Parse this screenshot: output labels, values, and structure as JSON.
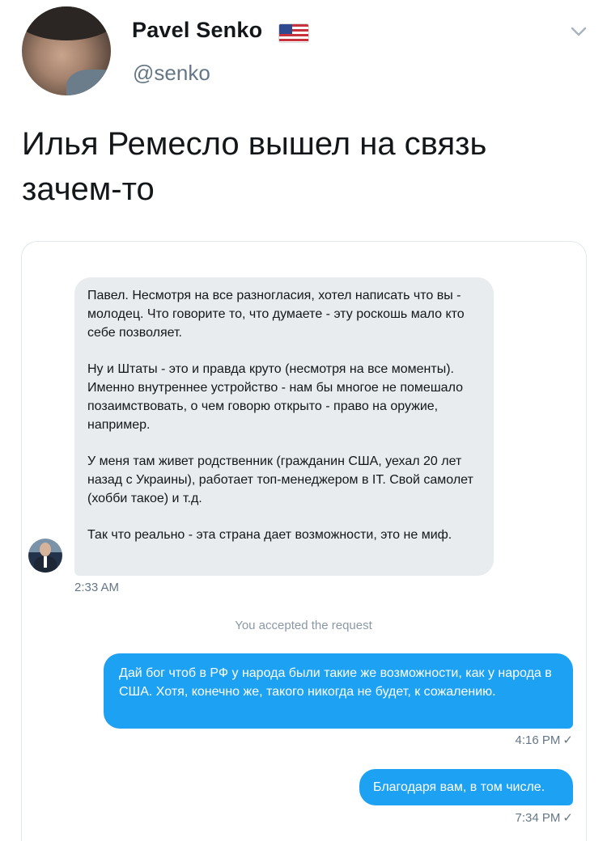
{
  "tweet": {
    "author_name": "Pavel Senko",
    "author_handle": "@senko",
    "text": "Илья Ремесло вышел на связь зачем-то",
    "icons": [
      "avatar",
      "us-flag-icon",
      "chevron-down-icon"
    ]
  },
  "conversation": {
    "incoming": {
      "paragraphs": [
        "Павел. Несмотря на все разногласия, хотел написать что вы - молодец. Что говорите то, что думаете - эту роскошь мало кто себе позволяет.",
        "Ну и Штаты - это и правда круто (несмотря на все моменты). Именно внутреннее устройство - нам бы многое не помешало позаимствовать, о чем говорю открыто - право на оружие, например.",
        "У меня там живет родственник (гражданин США, уехал 20 лет назад с Украины), работает топ-менеджером в IT. Свой самолет (хобби такое) и т.д.",
        "Так что реально - эта страна дает возможности, это не миф."
      ],
      "time": "2:33 AM"
    },
    "system_note": "You accepted the request",
    "outgoing": [
      {
        "text": "Дай бог чтоб в РФ у народа были такие же возможности, как у народа в США. Хотя, конечно же, такого никогда не будет, к сожалению.",
        "time": "4:16 PM"
      },
      {
        "text": "Благодаря вам, в том числе.",
        "time": "7:34 PM"
      }
    ],
    "read_mark": "✓"
  },
  "colors": {
    "accent": "#1da1f2",
    "incoming_bubble": "#e9ecef",
    "muted_text": "#657786"
  }
}
